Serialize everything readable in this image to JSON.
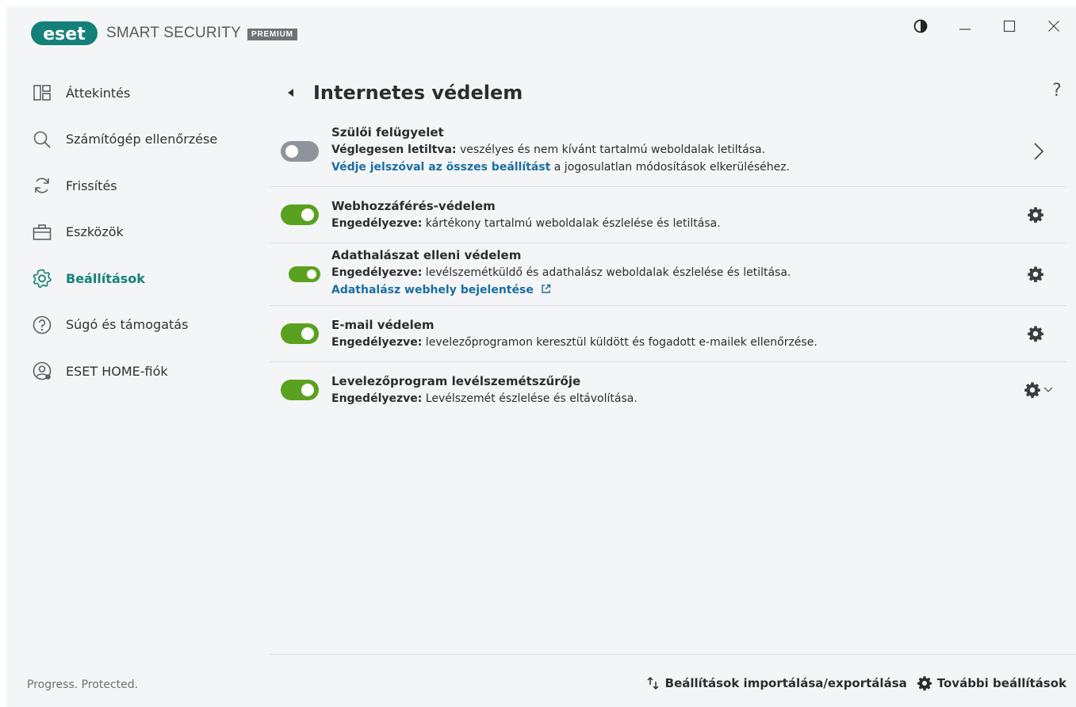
{
  "app": {
    "brand": "eset",
    "product": "SMART SECURITY",
    "edition": "PREMIUM",
    "tagline": "Progress. Protected."
  },
  "window_controls": [
    "contrast-icon",
    "minimize-icon",
    "maximize-icon",
    "close-icon"
  ],
  "sidebar": {
    "items": [
      {
        "label": "Áttekintés",
        "icon": "overview-icon",
        "active": false
      },
      {
        "label": "Számítógép ellenőrzése",
        "icon": "search-icon",
        "active": false
      },
      {
        "label": "Frissítés",
        "icon": "refresh-icon",
        "active": false
      },
      {
        "label": "Eszközök",
        "icon": "briefcase-icon",
        "active": false
      },
      {
        "label": "Beállítások",
        "icon": "gear-icon",
        "active": true
      },
      {
        "label": "Súgó és támogatás",
        "icon": "help-circle-icon",
        "active": false
      },
      {
        "label": "ESET HOME-fiók",
        "icon": "account-icon",
        "active": false
      }
    ]
  },
  "main": {
    "title": "Internetes védelem",
    "help": "?",
    "features": [
      {
        "title": "Szülői felügyelet",
        "status": "Véglegesen letiltva:",
        "desc": " veszélyes és nem kívánt tartalmú weboldalak letiltása.",
        "link": "Védje jelszóval az összes beállítást",
        "link_suffix": " a jogosulatlan módosítások elkerüléséhez.",
        "enabled": false,
        "action": "chevron-right-icon"
      },
      {
        "title": "Webhozzáférés-védelem",
        "status": "Engedélyezve:",
        "desc": " kártékony tartalmú weboldalak észlelése és letiltása.",
        "enabled": true,
        "action": "gear-icon"
      },
      {
        "title": "Adathalászat elleni védelem",
        "status": "Engedélyezve:",
        "desc": " levélszemétküldő és adathalász weboldalak észlelése és letiltása.",
        "link": "Adathalász webhely bejelentése",
        "enabled": true,
        "action": "gear-icon"
      },
      {
        "title": "E-mail védelem",
        "status": "Engedélyezve:",
        "desc": " levelezőprogramon keresztül küldött és fogadott e-mailek ellenőrzése.",
        "enabled": true,
        "action": "gear-icon"
      },
      {
        "title": "Levelezőprogram levélszemétszűrője",
        "status": "Engedélyezve:",
        "desc": " Levélszemét észlelése és eltávolítása.",
        "enabled": true,
        "action": "gear-dropdown-icon"
      }
    ]
  },
  "bottom": {
    "import_export": "Beállítások importálása/exportálása",
    "advanced": "További beállítások"
  },
  "colors": {
    "accent": "#14807a",
    "toggle_on": "#5aa11f",
    "toggle_off": "#8f949a",
    "link": "#1a6fa0",
    "background": "#f4f5f6"
  }
}
